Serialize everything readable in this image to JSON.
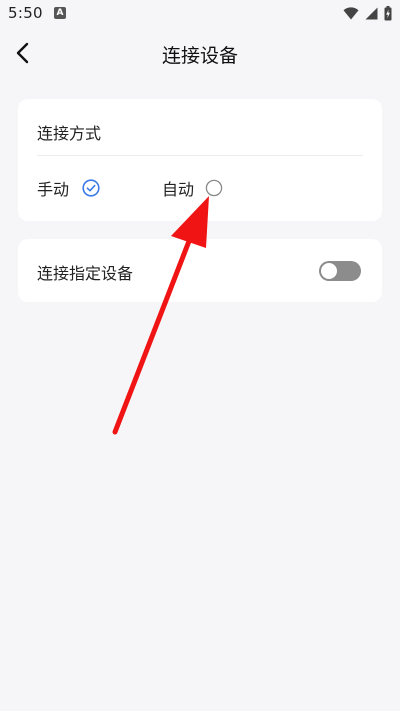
{
  "status_bar": {
    "time": "5:50",
    "icons": [
      "accessibility-a-icon",
      "wifi-icon",
      "signal-icon",
      "battery-charging-icon"
    ]
  },
  "header": {
    "title": "连接设备",
    "back_icon": "chevron-left-icon"
  },
  "connection_mode": {
    "label": "连接方式",
    "options": [
      {
        "label": "手动",
        "selected": true
      },
      {
        "label": "自动",
        "selected": false
      }
    ]
  },
  "specific_device": {
    "label": "连接指定设备",
    "toggle_on": false
  },
  "colors": {
    "accent": "#3b7ae8",
    "annotation": "#f01414",
    "background": "#f6f6f8",
    "card": "#ffffff",
    "toggle_off": "#8c8c8c"
  }
}
